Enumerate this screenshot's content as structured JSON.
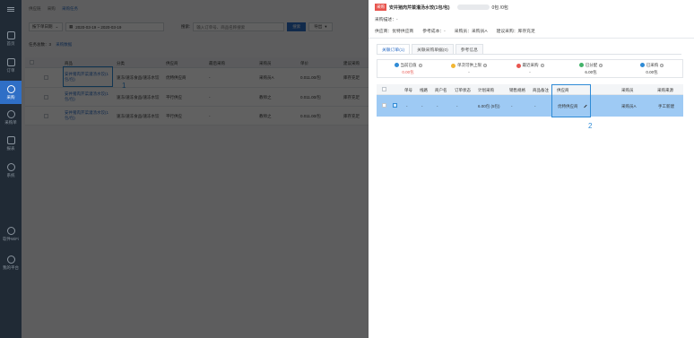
{
  "nav": {
    "items": [
      {
        "label": "首页"
      },
      {
        "label": "订单"
      },
      {
        "label": "采购"
      },
      {
        "label": "采购单"
      },
      {
        "label": "报表"
      },
      {
        "label": "系统"
      }
    ],
    "bottom": [
      {
        "label": "软件WiFi"
      },
      {
        "label": "我的平台"
      }
    ]
  },
  "bg": {
    "breadcrumb": [
      "供应链",
      "采购",
      "采购任务"
    ],
    "filter_type": "按下单日期",
    "date_range": "2020-03-19 ~ 2020-03-19",
    "search_label": "搜索:",
    "search_placeholder": "输入订单号、商品名称搜索",
    "search_btn": "搜索",
    "export_btn": "导出",
    "summary_label": "任务总数：3",
    "summary_link": "采购数据",
    "headers": [
      "商品",
      "分类",
      "供应商",
      "最后采购",
      "采购员",
      "单价",
      "建议采购"
    ],
    "rows": [
      {
        "product": "安井猪肉芹菜灌汤水饺(1包/包)",
        "category": "速冻/速冻食品/速冻水饺",
        "supplier": "优特供应商",
        "last": "-",
        "buyer": "采购员A",
        "price": "0.011.00/包",
        "suggest": "库存充足"
      },
      {
        "product": "安井猪肉芹菜灌汤水饺(1包/包)",
        "category": "速冻/速冻食品/速冻水饺",
        "supplier": "平行供应",
        "last": "-",
        "buyer": "教师之",
        "price": "0.011.00/包",
        "suggest": "库存充足"
      },
      {
        "product": "安井猪肉芹菜灌汤水饺(1包/包)",
        "category": "速冻/速冻食品/速冻水饺",
        "supplier": "平行供应",
        "last": "-",
        "buyer": "教师之",
        "price": "0.011.00/包",
        "suggest": "库存充足"
      }
    ],
    "annotation": "1"
  },
  "drawer": {
    "tag": "采购",
    "title": "安井猪肉芹菜灌汤水饺(1包/包)",
    "progress_text": "0包 /0包",
    "progress": 0,
    "desc": "采购描述：-",
    "info": [
      "供应商：优特供应商",
      "参考成本：-",
      "采购员：采购员A",
      "建议采购：库存充足"
    ],
    "tabs": [
      "关联订单(1)",
      "关联采购单据(0)",
      "参考信息"
    ],
    "active_tab": 0,
    "stats": [
      {
        "label": "当前已值",
        "value": "0.00包",
        "color": "#2f8bd6",
        "value_color": "#e8554e"
      },
      {
        "label": "单次可供上限",
        "value": "-",
        "color": "#f2b632",
        "value_color": "#333"
      },
      {
        "label": "最近采购",
        "value": "-",
        "color": "#e8554e",
        "value_color": "#333"
      },
      {
        "label": "已分配",
        "value": "6.00包",
        "color": "#43b36a",
        "value_color": "#333"
      },
      {
        "label": "已采购",
        "value": "0.00包",
        "color": "#2f8bd6",
        "value_color": "#333"
      }
    ],
    "headers": [
      "单号",
      "线路",
      "商户名",
      "订单状态",
      "计划采购",
      "销售规格",
      "商品备注",
      "供应商",
      "采购员",
      "采购来源"
    ],
    "row": {
      "order_no": "-",
      "route": "-",
      "merchant": "-",
      "status": "-",
      "plan": "6.00包 (5包)",
      "spec": "-",
      "note": "-",
      "supplier": "优特供应商",
      "buyer": "采购员A",
      "source": "手工新建"
    },
    "annotation": "2",
    "colors": {
      "accent": "#2f6fc6",
      "row_selected": "#9ecaf4",
      "annotation_box": "#2f8bd6"
    }
  }
}
